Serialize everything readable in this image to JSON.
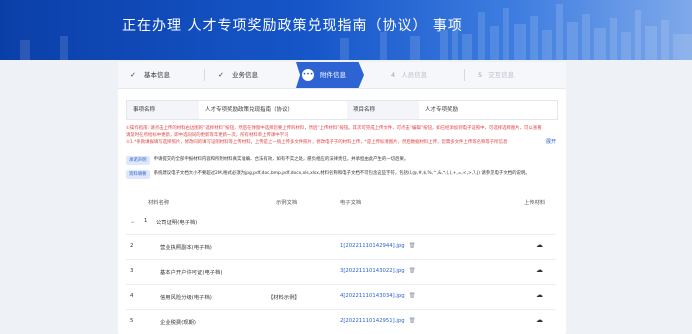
{
  "header": {
    "prefix": "正在办理",
    "title": "人才专项奖励政策兑现指南（协议）",
    "suffix": "事项"
  },
  "steps": [
    {
      "label": "基本信息",
      "state": "done",
      "mark": "✓"
    },
    {
      "label": "业务信息",
      "state": "done",
      "mark": "✓"
    },
    {
      "label": "附件信息",
      "state": "active",
      "mark": "•••"
    },
    {
      "label": "人员信息",
      "state": "pending",
      "mark": "4"
    },
    {
      "label": "交互信息",
      "state": "pending",
      "mark": "5"
    }
  ],
  "info": {
    "matter_label": "事项名称",
    "matter_value": "人才专项奖励政策兑现指南（协议）",
    "project_label": "项目名称",
    "project_value": "人才专项奖励"
  },
  "notes": {
    "line1": "①操作指南: 请点击上传的材料右边图的“选择材料”按钮，然后在弹窗中选择您要上传的材料，然后“上传材料”按钮。其次可完成上传文件，可点击“编辑”按钮，如已经添加到电子证照中，可选择选择图片，可以查看",
    "line2": "请及时在所给标中更新，即中选同同的更新等年更新一次，所有材料单上传课中学习",
    "line3": "②1.*条款填报填写选择照片，修改同的填写证明材料等上传材料，上传是上一统上传多文件照片，修改电子于的材料上传，*是上传标清图片，然后数据材料上传，您需多文件上传等名称等于所信息",
    "expand_label": "展开",
    "tag1": "承诺声明",
    "tag1_text": "申请提交的全部申报材料内容和所附材料真实准确、合法有效，如有不实之处，愿负相应的法律责任，并承担由此产生的一切后果。",
    "tag2": "资料填要",
    "tag2_text": "系统建议电子文档大小不要超过2M,格式必须为jpg,pdf,doc,bmp,pdf,docx,xls,xlsx,材料名称和电子文档不可包含这些字符，包括(I,@,#,$,%,^,&,*,(,),+,=,<,>,?,|) 请参见电子文档的说明。"
  },
  "table": {
    "headers": [
      "材料名称",
      "示例文档",
      "电子文档",
      "上传材料"
    ],
    "group": {
      "index": "1",
      "name": "公司证明(电子档)"
    },
    "rows": [
      {
        "index": "2",
        "name": "营业执照副本(电子档)",
        "example": "",
        "file": "1[20221110142944].jpg"
      },
      {
        "index": "3",
        "name": "基本户开户许可证(电子档)",
        "example": "",
        "file": "3[20221110143022].jpg"
      },
      {
        "index": "4",
        "name": "信用风险分级(电子档)",
        "example": "【材料示例】",
        "file": "4[20221110143034].jpg"
      },
      {
        "index": "5",
        "name": "企业税费(现期)",
        "example": "",
        "file": "2[20221110142951].jpg"
      }
    ]
  },
  "colors": {
    "primary": "#2d63d2",
    "danger": "#e04040",
    "banner": "#0b3fa8"
  },
  "icons": {
    "done": "check-icon",
    "trash": "trash-icon",
    "upload": "cloud-upload-icon"
  }
}
